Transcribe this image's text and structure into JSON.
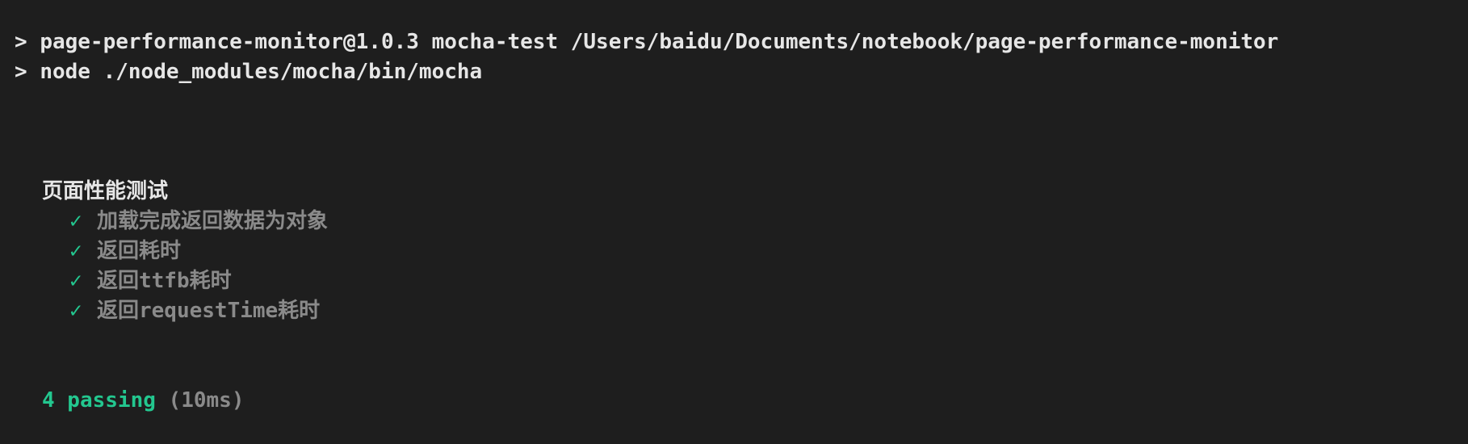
{
  "header": {
    "prompt_symbol": "> ",
    "line1": "page-performance-monitor@1.0.3 mocha-test /Users/baidu/Documents/notebook/page-performance-monitor",
    "line2": "node ./node_modules/mocha/bin/mocha"
  },
  "suite": {
    "title": "页面性能测试",
    "tests": [
      {
        "check": "✓",
        "label": "加载完成返回数据为对象"
      },
      {
        "check": "✓",
        "label": "返回耗时"
      },
      {
        "check": "✓",
        "label": "返回ttfb耗时"
      },
      {
        "check": "✓",
        "label": "返回requestTime耗时"
      }
    ]
  },
  "summary": {
    "passing": "4 passing",
    "duration": "(10ms)"
  },
  "colors": {
    "background": "#1e1e1e",
    "text": "#e6e6e6",
    "success": "#23c78f",
    "muted": "#8a8a8a"
  }
}
